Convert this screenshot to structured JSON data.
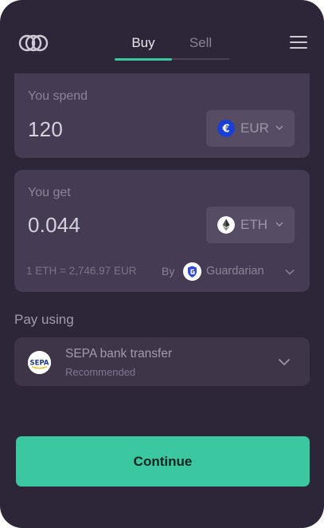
{
  "header": {
    "logo_icon": "linked-circles-logo",
    "tabs": [
      {
        "label": "Buy",
        "active": true
      },
      {
        "label": "Sell",
        "active": false
      }
    ],
    "menu_icon": "hamburger-menu-icon"
  },
  "spend": {
    "label": "You spend",
    "amount": "120",
    "currency": {
      "code": "EUR",
      "icon": "euro-icon"
    }
  },
  "get": {
    "label": "You get",
    "amount": "0.044",
    "currency": {
      "code": "ETH",
      "icon": "ethereum-icon"
    },
    "rate": "1 ETH = 2,746.97 EUR",
    "by_label": "By",
    "provider": {
      "name": "Guardarian",
      "icon": "guardarian-logo-icon"
    }
  },
  "pay": {
    "label": "Pay using",
    "method": "SEPA bank transfer",
    "sublabel": "Recommended",
    "icon": "sepa-logo-icon"
  },
  "actions": {
    "continue_label": "Continue"
  },
  "colors": {
    "background": "#2d2538",
    "card": "#453b52",
    "accent": "#3bc79f",
    "euro_blue": "#1a3fd6"
  }
}
